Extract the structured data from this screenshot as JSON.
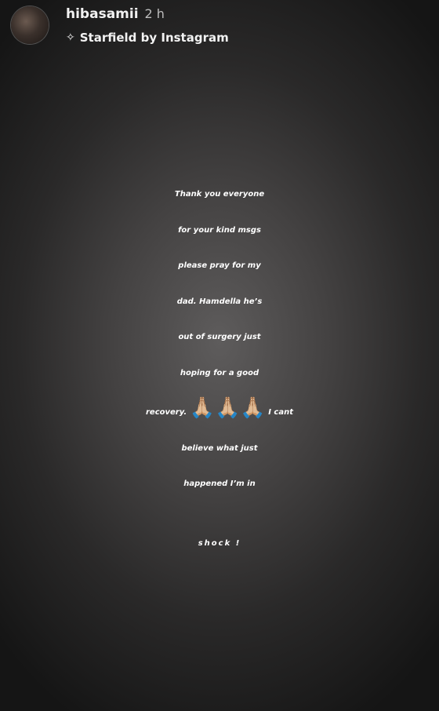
{
  "header": {
    "username": "hibasamii",
    "time": "2 h",
    "effect_icon": "sparkle-icon",
    "effect_label": "Starfield by Instagram"
  },
  "message": {
    "lines": [
      "Thank you everyone",
      "for your kind msgs",
      "please pray for my",
      "dad. Hamdella he’s",
      "out of surgery just",
      "hoping for a good"
    ],
    "line7_before": "recovery. ",
    "line7_emoji": "🙏🏼🙏🏼🙏🏼",
    "line7_after": " I cant",
    "line8": "believe what just",
    "line9": "happened I’m in",
    "emphasis": "shock !"
  }
}
